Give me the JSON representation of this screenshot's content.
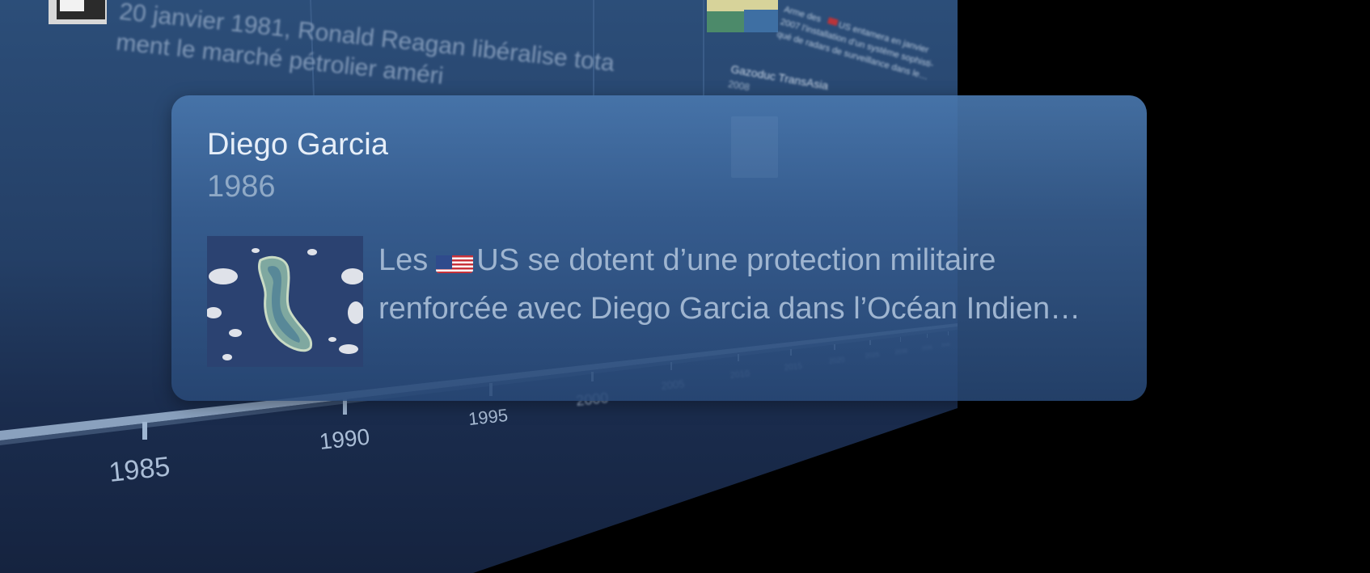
{
  "popover": {
    "title": "Diego Garcia",
    "year": "1986",
    "description_prefix": "Les",
    "description_flag_icon": "us-flag-icon",
    "description_rest": "US se dotent d’une protection militaire renforcée avec Diego Garcia dans l’Océan Indien…",
    "image_icon": "atoll-satellite-image"
  },
  "background_timeline": {
    "event_text_line1": "20 janvier 1981, Ronald Reagan libéralise tota",
    "event_text_line2": "ment le marché pétrolier améri",
    "right_card_line1": "Arme des",
    "right_card_line1b": "US entamera en janvier",
    "right_card_line2": "2007 l’installation d’un système sophisti-",
    "right_card_line3": "qué de radars de surveillance dans le…",
    "right_card_title": "Gazoduc TransAsia",
    "right_card_year": "2008",
    "axis_years": [
      "1985",
      "1990",
      "1995",
      "2000",
      "2005",
      "2010",
      "2015",
      "2020",
      "2025",
      "2030",
      "2035",
      "2040"
    ]
  },
  "colors": {
    "background": "#000000",
    "wall_top": "#2c4e79",
    "wall_bottom": "#15233f",
    "card_top": "#4876ac",
    "card_bottom": "#284876",
    "title_text": "#e6eef8",
    "muted_text": "#8fa9c6"
  }
}
